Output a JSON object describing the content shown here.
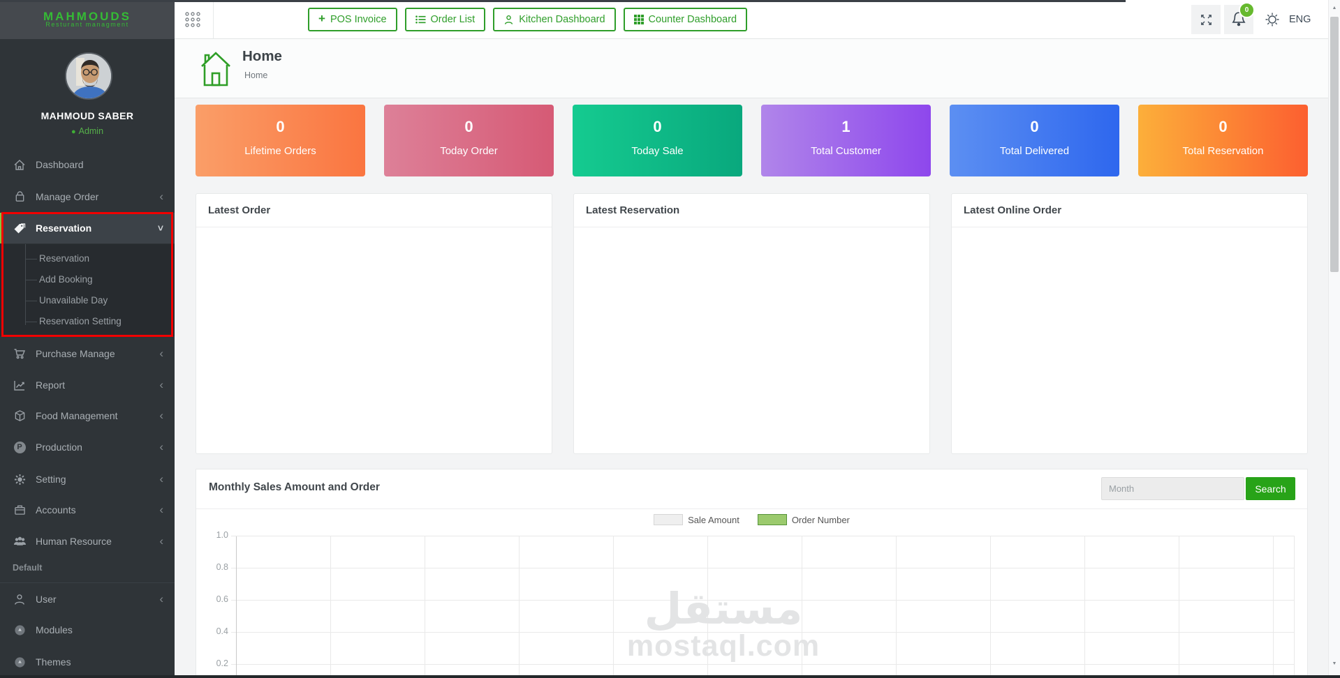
{
  "header": {
    "logo": {
      "title": "MAHMOUDS",
      "subtitle": "Resturant managment"
    },
    "quick_buttons": [
      {
        "label": "POS Invoice",
        "icon": "plus-icon"
      },
      {
        "label": "Order List",
        "icon": "list-icon"
      },
      {
        "label": "Kitchen Dashboard",
        "icon": "person-icon"
      },
      {
        "label": "Counter Dashboard",
        "icon": "grid-icon"
      }
    ],
    "notification_badge": "0",
    "language": "ENG"
  },
  "sidebar": {
    "user": {
      "name": "MAHMOUD SABER",
      "role": "Admin"
    },
    "items": [
      {
        "label": "Dashboard",
        "icon": "home-icon"
      },
      {
        "label": "Manage Order",
        "icon": "bag-icon"
      },
      {
        "label": "Reservation",
        "icon": "tag-icon",
        "expanded": true,
        "children": [
          "Reservation",
          "Add Booking",
          "Unavailable Day",
          "Reservation Setting"
        ]
      },
      {
        "label": "Purchase Manage",
        "icon": "cart-icon"
      },
      {
        "label": "Report",
        "icon": "chart-icon"
      },
      {
        "label": "Food Management",
        "icon": "cube-icon"
      },
      {
        "label": "Production",
        "icon": "production-icon"
      },
      {
        "label": "Setting",
        "icon": "gear-icon"
      },
      {
        "label": "Accounts",
        "icon": "briefcase-icon"
      },
      {
        "label": "Human Resource",
        "icon": "people-icon"
      }
    ],
    "section_label": "Default",
    "secondary_items": [
      {
        "label": "User",
        "icon": "user-icon"
      },
      {
        "label": "Modules",
        "icon": "module-icon"
      },
      {
        "label": "Themes",
        "icon": "theme-icon"
      }
    ]
  },
  "page": {
    "title": "Home",
    "breadcrumb": "Home"
  },
  "stat_cards": [
    {
      "value": "0",
      "label": "Lifetime Orders",
      "gradient_from": "#fa9e68",
      "gradient_to": "#fa7540"
    },
    {
      "value": "0",
      "label": "Today Order",
      "gradient_from": "#dd8098",
      "gradient_to": "#d65a75"
    },
    {
      "value": "0",
      "label": "Today Sale",
      "gradient_from": "#15cb90",
      "gradient_to": "#09a87d"
    },
    {
      "value": "1",
      "label": "Total Customer",
      "gradient_from": "#b085ea",
      "gradient_to": "#8e47ec"
    },
    {
      "value": "0",
      "label": "Total Delivered",
      "gradient_from": "#5c8ff2",
      "gradient_to": "#2e67ee"
    },
    {
      "value": "0",
      "label": "Total Reservation",
      "gradient_from": "#fcaf3a",
      "gradient_to": "#fc5f30"
    }
  ],
  "panels": [
    {
      "title": "Latest Order"
    },
    {
      "title": "Latest Reservation"
    },
    {
      "title": "Latest Online Order"
    }
  ],
  "sales_panel": {
    "title": "Monthly Sales Amount and Order",
    "month_placeholder": "Month",
    "search_label": "Search",
    "chart_data": {
      "type": "line",
      "series": [
        {
          "name": "Sale Amount",
          "color": "#efefef",
          "values": []
        },
        {
          "name": "Order Number",
          "color": "#9bca6d",
          "values": []
        }
      ],
      "y_tick_labels": [
        "1.0",
        "0.8",
        "0.6",
        "0.4",
        "0.2"
      ],
      "ylim": [
        0,
        1
      ],
      "grid": true,
      "legend_position": "top-center"
    }
  },
  "watermark": {
    "logo_text": "مستقل",
    "domain": "mostaql.com"
  },
  "accent_colors": {
    "green": "#2f9e2a",
    "search_green": "#28a318",
    "badge_green": "#66b92e",
    "sidebar_bg": "#2f3438",
    "active_border_green": "#86c440",
    "annotation_red": "#f10000"
  }
}
